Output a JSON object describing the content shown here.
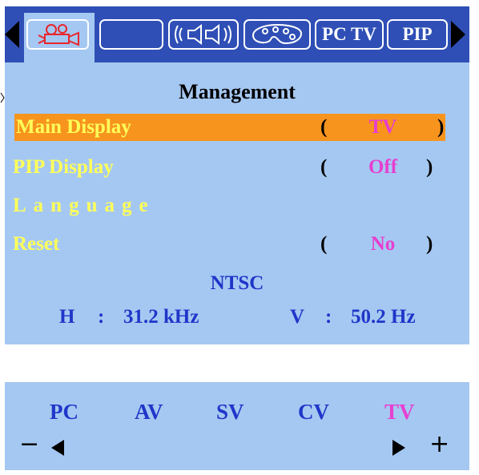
{
  "tabs": [
    {
      "icon": "projector-icon",
      "label": "",
      "active": true
    },
    {
      "icon": "blank-tab",
      "label": ""
    },
    {
      "icon": "speaker-icon",
      "label": ""
    },
    {
      "icon": "palette-icon",
      "label": ""
    },
    {
      "icon": "pctv-tab",
      "label": "PC TV"
    },
    {
      "icon": "pip-tab",
      "label": "PIP"
    }
  ],
  "menu": {
    "title": "Management",
    "items": [
      {
        "label": "Main Display",
        "value": "TV",
        "open": "(",
        "close": ")"
      },
      {
        "label": "PIP Display",
        "value": "Off",
        "open": "(",
        "close": ")"
      },
      {
        "label": "Language",
        "value": "",
        "open": "",
        "close": ""
      },
      {
        "label": "Reset",
        "value": "No",
        "open": "(",
        "close": ")"
      }
    ]
  },
  "signal": {
    "standard": "NTSC",
    "h_label": "H",
    "h_sep": ":",
    "h_value": "31.2 kHz",
    "v_label": "V",
    "v_sep": ":",
    "v_value": "50.2 Hz"
  },
  "sources": {
    "items": [
      "PC",
      "AV",
      "SV",
      "CV",
      "TV"
    ],
    "selected": "TV",
    "minus": "−",
    "plus": "+"
  },
  "colors": {
    "panel": "#a5c8f2",
    "tabbar": "#2f4fb6",
    "highlight": "#f7941d",
    "label": "#ffff5a",
    "value": "#e63fd0",
    "info": "#1f36c9"
  }
}
